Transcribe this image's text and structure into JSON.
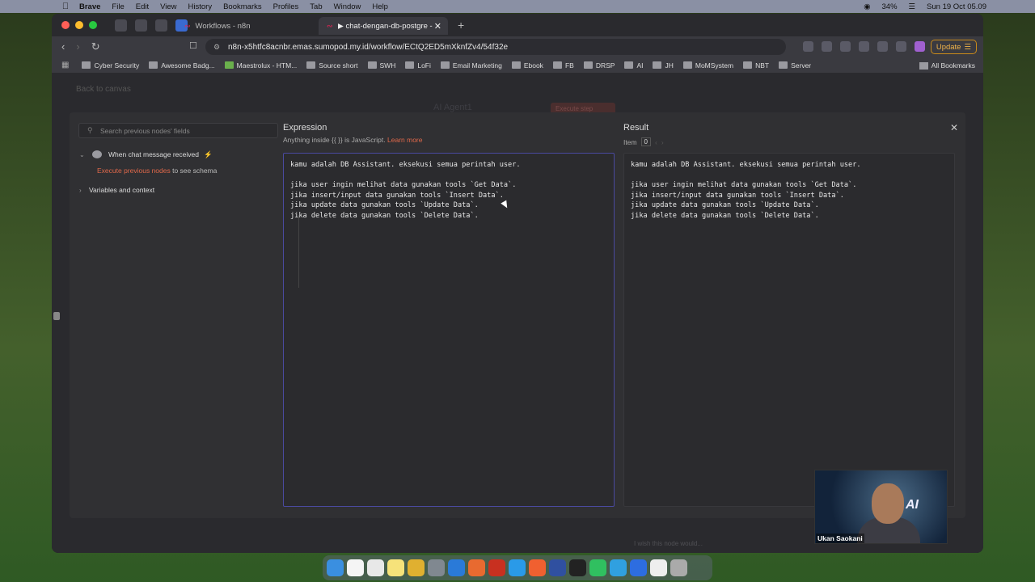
{
  "menubar": {
    "app": "Brave",
    "items": [
      "File",
      "Edit",
      "View",
      "History",
      "Bookmarks",
      "Profiles",
      "Tab",
      "Window",
      "Help"
    ],
    "battery": "34%",
    "datetime": "Sun 19 Oct 05.09"
  },
  "browser": {
    "tabs": [
      {
        "label": "Workflows - n8n"
      },
      {
        "label": "▶ chat-dengan-db-postgre - n8n"
      }
    ],
    "url": "n8n-x5htfc8acnbr.emas.sumopod.my.id/workflow/ECtQ2ED5mXknfZv4/54f32e",
    "update_label": "Update",
    "bookmarks": [
      "Cyber Security",
      "Awesome Badg...",
      "Maestrolux - HTM...",
      "Source short",
      "SWH",
      "LoFi",
      "Email Marketing",
      "Ebook",
      "FB",
      "DRSP",
      "AI",
      "JH",
      "MoMSystem",
      "NBT",
      "Server"
    ],
    "all_bookmarks": "All Bookmarks"
  },
  "page": {
    "back_label": "Back to canvas",
    "ghost_node": "AI Agent1",
    "ghost_button": "Execute step",
    "wish_text": "I wish this node would..."
  },
  "modal": {
    "search_placeholder": "Search previous nodes' fields",
    "tree": {
      "node": "When chat message received",
      "exec_link": "Execute previous nodes",
      "exec_rest": " to see schema",
      "vars": "Variables and context"
    },
    "expression": {
      "title": "Expression",
      "hint_prefix": "Anything inside {{ }} is JavaScript.",
      "learn_more": "Learn more",
      "lines": [
        "kamu adalah DB Assistant. eksekusi semua perintah user.",
        "",
        "jika user ingin melihat data gunakan tools `Get Data`.",
        "jika insert/input data gunakan tools `Insert Data`.",
        "jika update data gunakan tools `Update Data`.",
        "jika delete data gunakan tools `Delete Data`."
      ]
    },
    "result": {
      "title": "Result",
      "item_label": "Item",
      "item_value": "0",
      "lines": [
        "kamu adalah DB Assistant. eksekusi semua perintah user.",
        "",
        "jika user ingin melihat data gunakan tools `Get Data`.",
        "jika insert/input data gunakan tools `Insert Data`.",
        "jika update data gunakan tools `Update Data`.",
        "jika delete data gunakan tools `Delete Data`."
      ]
    }
  },
  "camera": {
    "name": "Ukan Saokani",
    "overlay_text": "AI"
  },
  "colors": {
    "accent": "#e0684a",
    "editor_border": "#4a4aa0",
    "update": "#f0b34a"
  }
}
